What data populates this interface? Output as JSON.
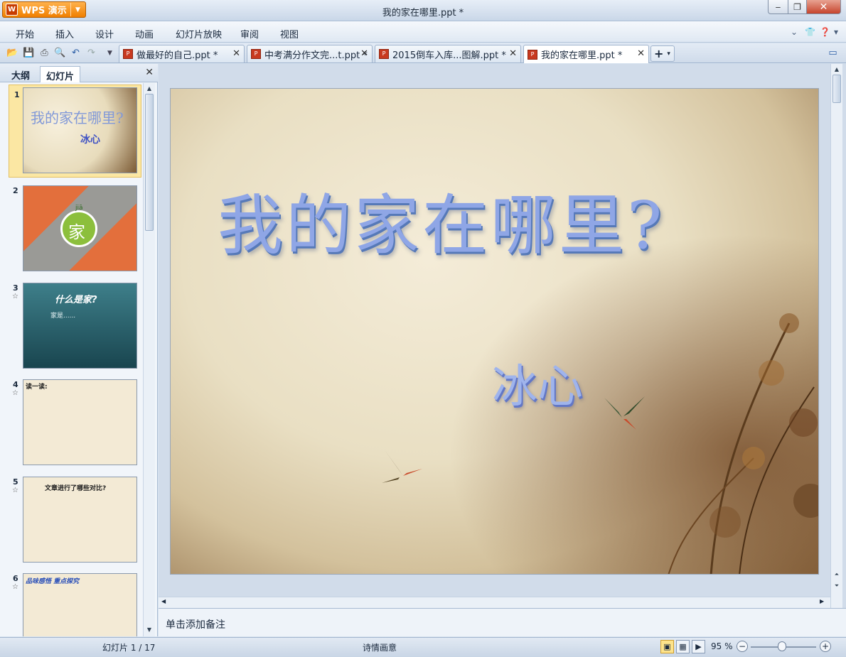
{
  "app": {
    "name": "WPS 演示",
    "window_title": "我的家在哪里.ppt *"
  },
  "menu": [
    "开始",
    "插入",
    "设计",
    "动画",
    "幻灯片放映",
    "审阅",
    "视图"
  ],
  "doc_tabs": [
    {
      "label": "做最好的自己.ppt *",
      "active": false
    },
    {
      "label": "中考满分作文完...t.ppt *",
      "active": false
    },
    {
      "label": "2015倒车入库...图解.ppt *",
      "active": false
    },
    {
      "label": "我的家在哪里.ppt *",
      "active": true
    }
  ],
  "panel": {
    "tabs": [
      "大纲",
      "幻灯片"
    ],
    "active_tab": "幻灯片",
    "slides": [
      {
        "num": "1",
        "star": "",
        "title": "我的家在哪里?",
        "subtitle": "冰心"
      },
      {
        "num": "2",
        "star": "",
        "title": "家",
        "subtitle": "jiā"
      },
      {
        "num": "3",
        "star": "☆",
        "title": "什么是家?",
        "subtitle": "家是......"
      },
      {
        "num": "4",
        "star": "☆",
        "title": "读一读:",
        "subtitle": ""
      },
      {
        "num": "5",
        "star": "☆",
        "title": "文章进行了哪些对比?",
        "subtitle": ""
      },
      {
        "num": "6",
        "star": "☆",
        "title": "品味感悟 重点探究",
        "subtitle": ""
      }
    ]
  },
  "slide": {
    "title": "我的家在哪里?",
    "author": "冰心"
  },
  "notes_placeholder": "单击添加备注",
  "status": {
    "slide_counter": "幻灯片 1 / 17",
    "theme": "诗情画意",
    "zoom": "95 %"
  }
}
